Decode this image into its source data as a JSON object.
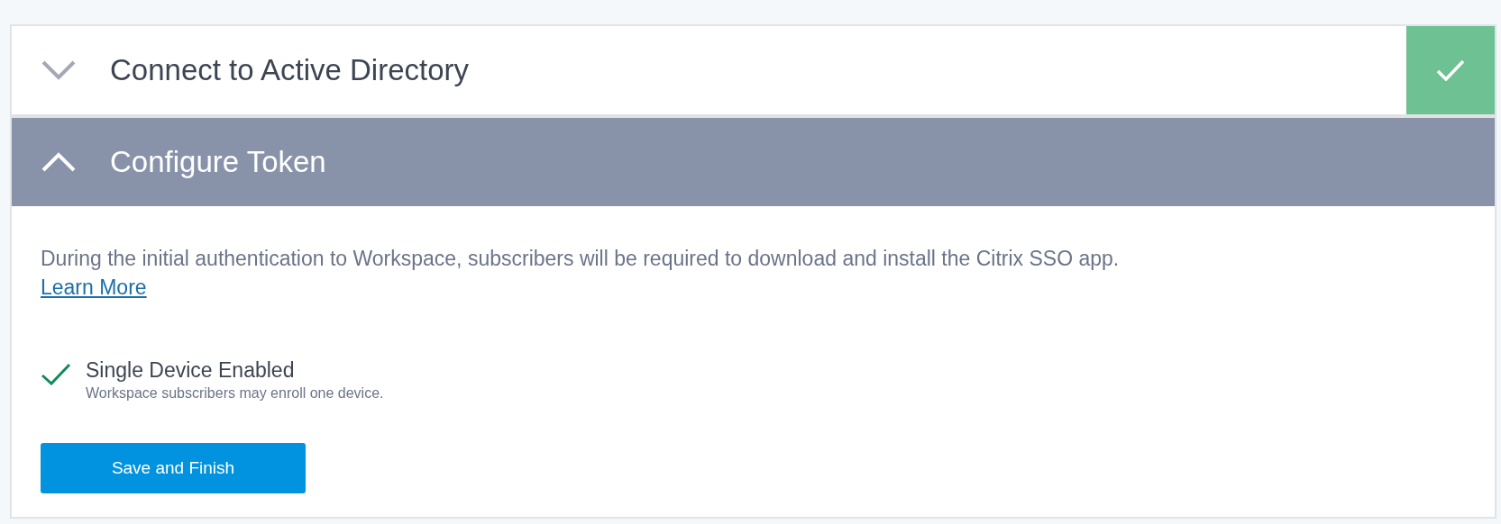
{
  "sections": [
    {
      "title": "Connect to Active Directory",
      "expanded": false,
      "completed": true
    },
    {
      "title": "Configure Token",
      "expanded": true,
      "completed": false,
      "body": {
        "description": "During the initial authentication to Workspace, subscribers will be required to download and install the Citrix SSO app.",
        "link": "Learn More",
        "options": [
          {
            "label": "Single Device Enabled",
            "hint": "Workspace subscribers may enroll one device.",
            "checked": true
          }
        ],
        "button": "Save and Finish"
      }
    }
  ]
}
